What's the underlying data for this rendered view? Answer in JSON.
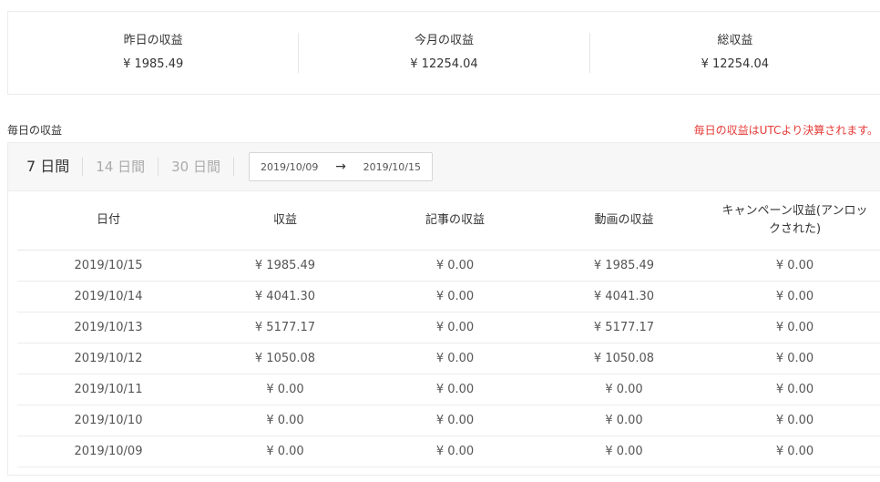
{
  "summary": {
    "yesterday": {
      "label": "昨日の収益",
      "value": "¥ 1985.49"
    },
    "month": {
      "label": "今月の収益",
      "value": "¥ 12254.04"
    },
    "total": {
      "label": "総収益",
      "value": "¥ 12254.04"
    }
  },
  "section_title": "毎日の収益",
  "notice": "毎日の収益はUTCより決算されます。",
  "filters": {
    "tabs": [
      {
        "label": "7 日間",
        "active": true
      },
      {
        "label": "14 日間",
        "active": false
      },
      {
        "label": "30 日間",
        "active": false
      }
    ],
    "date_start": "2019/10/09",
    "date_end": "2019/10/15",
    "arrow": "→"
  },
  "table": {
    "columns": [
      "日付",
      "収益",
      "記事の収益",
      "動画の収益",
      "キャンペーン収益(アンロックされた)"
    ],
    "rows": [
      [
        "2019/10/15",
        "¥ 1985.49",
        "¥ 0.00",
        "¥ 1985.49",
        "¥ 0.00"
      ],
      [
        "2019/10/14",
        "¥ 4041.30",
        "¥ 0.00",
        "¥ 4041.30",
        "¥ 0.00"
      ],
      [
        "2019/10/13",
        "¥ 5177.17",
        "¥ 0.00",
        "¥ 5177.17",
        "¥ 0.00"
      ],
      [
        "2019/10/12",
        "¥ 1050.08",
        "¥ 0.00",
        "¥ 1050.08",
        "¥ 0.00"
      ],
      [
        "2019/10/11",
        "¥ 0.00",
        "¥ 0.00",
        "¥ 0.00",
        "¥ 0.00"
      ],
      [
        "2019/10/10",
        "¥ 0.00",
        "¥ 0.00",
        "¥ 0.00",
        "¥ 0.00"
      ],
      [
        "2019/10/09",
        "¥ 0.00",
        "¥ 0.00",
        "¥ 0.00",
        "¥ 0.00"
      ]
    ]
  }
}
